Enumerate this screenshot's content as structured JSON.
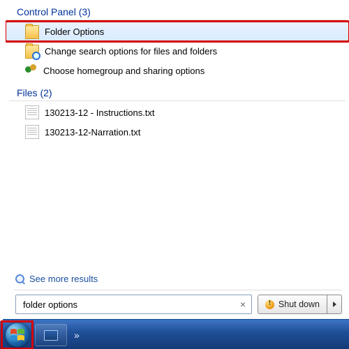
{
  "groups": {
    "control_panel": {
      "label": "Control Panel (3)",
      "items": [
        {
          "label": "Folder Options"
        },
        {
          "label": "Change search options for files and folders"
        },
        {
          "label": "Choose homegroup and sharing options"
        }
      ]
    },
    "files": {
      "label": "Files (2)",
      "items": [
        {
          "label": "130213-12 - Instructions.txt"
        },
        {
          "label": "130213-12-Narration.txt"
        }
      ]
    }
  },
  "see_more": "See more results",
  "search": {
    "value": "folder options",
    "clear": "×"
  },
  "shutdown": {
    "label": "Shut down"
  },
  "taskbar": {
    "overflow": "»"
  }
}
